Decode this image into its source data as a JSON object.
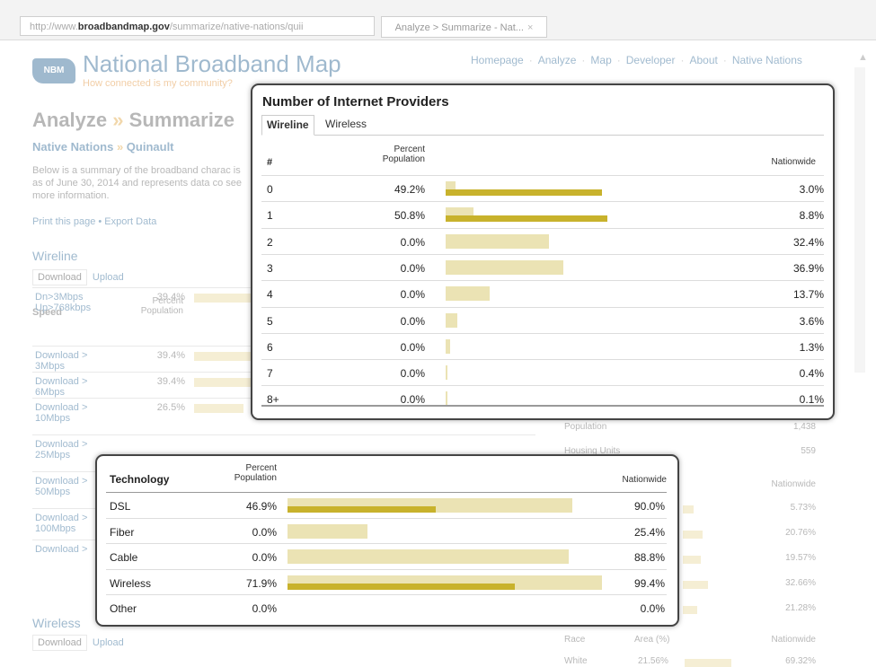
{
  "browser": {
    "url_prefix": "http://www.",
    "url_domain": "broadbandmap.gov",
    "url_path": "/summarize/native-nations/quii",
    "tab_label": "Analyze > Summarize - Nat...",
    "tab_close": "×"
  },
  "site": {
    "logo_text": "NBM",
    "title": "National Broadband Map",
    "tagline": "How connected is my community?",
    "nav": [
      "Homepage",
      "Analyze",
      "Map",
      "Developer",
      "About",
      "Native Nations"
    ],
    "nav_sep": "·"
  },
  "page": {
    "heading_part1": "Analyze",
    "heading_sep": "»",
    "heading_part2": "Summarize",
    "crumb_part1": "Native Nations",
    "crumb_sep": "»",
    "crumb_part2": "Quinault",
    "description": "Below is a summary of the broadband charac is as of June 30, 2014 and represents data co see more information.",
    "links": "Print this page • Export Data",
    "wireline_heading": "Wireline",
    "tab_download": "Download",
    "tab_upload": "Upload",
    "speed_col": "Speed",
    "percent_col": "Percent Population",
    "speed_rows": [
      {
        "label": "Dn>3Mbps Up>768kbps",
        "value": "39.4%"
      },
      {
        "label": "Download > 3Mbps",
        "value": "39.4%"
      },
      {
        "label": "Download > 6Mbps",
        "value": "39.4%"
      },
      {
        "label": "Download > 10Mbps",
        "value": "26.5%"
      },
      {
        "label": "Download > 25Mbps",
        "value": ""
      },
      {
        "label": "Download > 50Mbps",
        "value": ""
      },
      {
        "label": "Download > 100Mbps",
        "value": ""
      },
      {
        "label": "Download >",
        "value": ""
      }
    ],
    "wireless_heading": "Wireless",
    "tab2_download": "Download",
    "tab2_upload": "Upload",
    "right_population_label": "Population",
    "right_population_value": "1,438",
    "right_housing_label": "Housing Units",
    "right_housing_value": "559",
    "right_nationwide": "Nationwide",
    "right_values": [
      "5.73%",
      "20.76%",
      "19.57%",
      "32.66%",
      "21.28%"
    ],
    "race_col": "Race",
    "area_col": "Area (%)",
    "race_nationwide": "Nationwide",
    "race_row_label": "White",
    "race_row_area": "21.56%",
    "race_row_nat": "69.32%"
  },
  "providers_card": {
    "title": "Number of Internet Providers",
    "tab_active": "Wireline",
    "tab_inactive": "Wireless",
    "col_num": "#",
    "col_percent": "Percent Population",
    "col_nationwide": "Nationwide",
    "rows": [
      {
        "num": "0",
        "percent": "49.2%",
        "nationwide": "3.0%",
        "pct_val": 49.2,
        "nat_val": 3.0
      },
      {
        "num": "1",
        "percent": "50.8%",
        "nationwide": "8.8%",
        "pct_val": 50.8,
        "nat_val": 8.8
      },
      {
        "num": "2",
        "percent": "0.0%",
        "nationwide": "32.4%",
        "pct_val": 0.0,
        "nat_val": 32.4
      },
      {
        "num": "3",
        "percent": "0.0%",
        "nationwide": "36.9%",
        "pct_val": 0.0,
        "nat_val": 36.9
      },
      {
        "num": "4",
        "percent": "0.0%",
        "nationwide": "13.7%",
        "pct_val": 0.0,
        "nat_val": 13.7
      },
      {
        "num": "5",
        "percent": "0.0%",
        "nationwide": "3.6%",
        "pct_val": 0.0,
        "nat_val": 3.6
      },
      {
        "num": "6",
        "percent": "0.0%",
        "nationwide": "1.3%",
        "pct_val": 0.0,
        "nat_val": 1.3
      },
      {
        "num": "7",
        "percent": "0.0%",
        "nationwide": "0.4%",
        "pct_val": 0.0,
        "nat_val": 0.4
      },
      {
        "num": "8+",
        "percent": "0.0%",
        "nationwide": "0.1%",
        "pct_val": 0.0,
        "nat_val": 0.1
      }
    ]
  },
  "technology_card": {
    "col_tech": "Technology",
    "col_percent": "Percent Population",
    "col_nationwide": "Nationwide",
    "rows": [
      {
        "tech": "DSL",
        "percent": "46.9%",
        "nationwide": "90.0%",
        "pct_val": 46.9,
        "nat_val": 90.0
      },
      {
        "tech": "Fiber",
        "percent": "0.0%",
        "nationwide": "25.4%",
        "pct_val": 0.0,
        "nat_val": 25.4
      },
      {
        "tech": "Cable",
        "percent": "0.0%",
        "nationwide": "88.8%",
        "pct_val": 0.0,
        "nat_val": 88.8
      },
      {
        "tech": "Wireless",
        "percent": "71.9%",
        "nationwide": "99.4%",
        "pct_val": 71.9,
        "nat_val": 99.4
      },
      {
        "tech": "Other",
        "percent": "0.0%",
        "nationwide": "0.0%",
        "pct_val": 0.0,
        "nat_val": 0.0
      }
    ]
  },
  "colors": {
    "bar_nationwide": "#ebe3b4",
    "bar_local": "#c8b22c",
    "brand_blue": "#1c5a8c",
    "accent_orange": "#e08a2c"
  }
}
